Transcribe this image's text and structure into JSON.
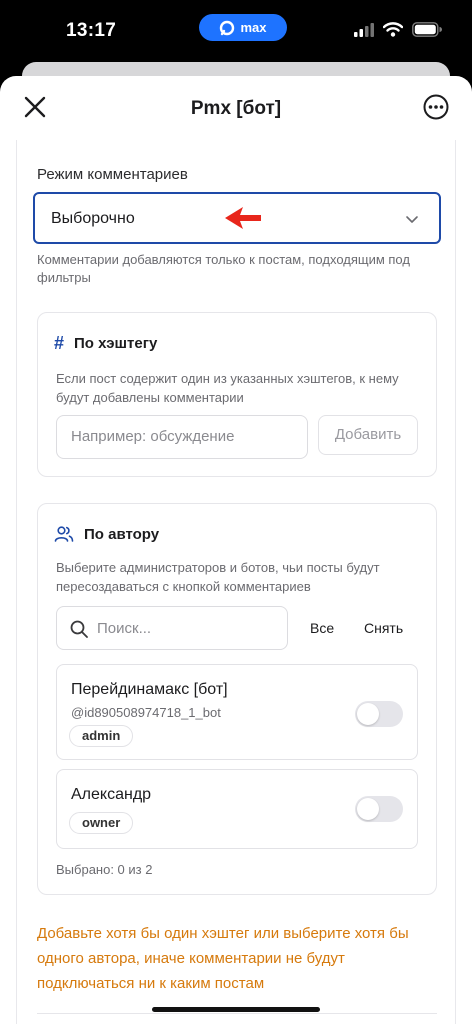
{
  "status_bar": {
    "time": "13:17",
    "app_pill": "max"
  },
  "nav": {
    "title": "Pmx [бот]"
  },
  "mode": {
    "label": "Режим комментариев",
    "selected": "Выборочно",
    "hint": "Комментарии добавляются только к постам, подходящим под фильтры"
  },
  "hashtag": {
    "title": "По хэштегу",
    "description": "Если пост содержит один из указанных хэштегов, к нему будут добавлены комментарии",
    "placeholder": "Например: обсуждение",
    "add_label": "Добавить"
  },
  "author": {
    "title": "По автору",
    "description": "Выберите администраторов и ботов, чьи посты будут пересоздаваться с кнопкой комментариев",
    "search_placeholder": "Поиск...",
    "all_label": "Все",
    "clear_label": "Снять",
    "items": [
      {
        "name": "Перейдинамакс [бот]",
        "handle": "@id890508974718_1_bot",
        "role": "admin",
        "enabled": false
      },
      {
        "name": "Александр",
        "role": "owner",
        "enabled": false
      }
    ],
    "selected_text": "Выбрано: 0 из 2"
  },
  "warning": "Добавьте хотя бы один хэштег или выберите хотя бы одного автора, иначе комментарии не будут подключаться ни к каким постам",
  "colors": {
    "accent": "#1e73ff",
    "select_border": "#1e4aa8",
    "warning": "#d67a0d",
    "arrow": "#e8261b"
  }
}
